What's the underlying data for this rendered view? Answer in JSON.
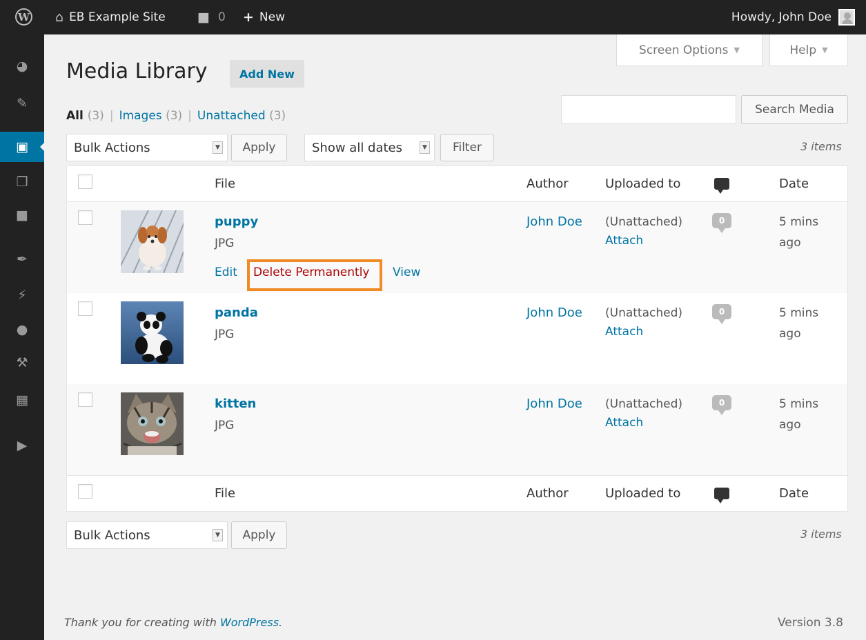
{
  "adminbar": {
    "wp_logo": "W",
    "site_name": "EB Example Site",
    "comments_count": "0",
    "new_label": "New",
    "howdy": "Howdy, John Doe",
    "home_icon": "home-icon",
    "comment_icon": "comment-icon",
    "plus_icon": "plus-icon"
  },
  "sidebar": {
    "items": [
      {
        "icon": "dashboard-icon",
        "glyph": "◕"
      },
      {
        "icon": "pin-icon",
        "glyph": "✎"
      },
      {
        "icon": "media-icon",
        "glyph": "▣"
      },
      {
        "icon": "pages-icon",
        "glyph": "❐"
      },
      {
        "icon": "comments-icon",
        "glyph": "■"
      },
      {
        "icon": "appearance-icon",
        "glyph": "✒"
      },
      {
        "icon": "plugins-icon",
        "glyph": "⚡"
      },
      {
        "icon": "users-icon",
        "glyph": "●"
      },
      {
        "icon": "tools-icon",
        "glyph": "⚒"
      },
      {
        "icon": "settings-icon",
        "glyph": "▦"
      },
      {
        "icon": "collapse-icon",
        "glyph": "▶"
      }
    ]
  },
  "screen_meta": {
    "screen_options": "Screen Options",
    "help": "Help"
  },
  "header": {
    "title": "Media Library",
    "add_new": "Add New"
  },
  "filters": {
    "all": "All",
    "all_count": "(3)",
    "images": "Images",
    "images_count": "(3)",
    "unattached": "Unattached",
    "unattached_count": "(3)",
    "separator": "|"
  },
  "search": {
    "value": "",
    "button": "Search Media"
  },
  "top_controls": {
    "bulk_actions": "Bulk Actions",
    "apply": "Apply",
    "dates": "Show all dates",
    "filter": "Filter",
    "items_count": "3 items"
  },
  "table": {
    "columns": {
      "file": "File",
      "author": "Author",
      "uploaded_to": "Uploaded to",
      "date": "Date"
    },
    "rows": [
      {
        "name": "puppy",
        "type": "JPG",
        "author": "John Doe",
        "uploaded": "(Unattached)",
        "attach": "Attach",
        "comments": "0",
        "date_line1": "5 mins",
        "date_line2": "ago",
        "actions": {
          "edit": "Edit",
          "delete": "Delete Permanently",
          "view": "View"
        }
      },
      {
        "name": "panda",
        "type": "JPG",
        "author": "John Doe",
        "uploaded": "(Unattached)",
        "attach": "Attach",
        "comments": "0",
        "date_line1": "5 mins",
        "date_line2": "ago"
      },
      {
        "name": "kitten",
        "type": "JPG",
        "author": "John Doe",
        "uploaded": "(Unattached)",
        "attach": "Attach",
        "comments": "0",
        "date_line1": "5 mins",
        "date_line2": "ago"
      }
    ]
  },
  "bottom_controls": {
    "bulk_actions": "Bulk Actions",
    "apply": "Apply",
    "items_count": "3 items"
  },
  "footer": {
    "thanks_prefix": "Thank you for creating with ",
    "wordpress_link": "WordPress",
    "thanks_suffix": ".",
    "version": "Version 3.8"
  },
  "colors": {
    "admin_bar": "#222222",
    "link": "#0074a2",
    "delete": "#aa0000",
    "highlight": "#f08a24",
    "current_menu": "#0074a2"
  }
}
